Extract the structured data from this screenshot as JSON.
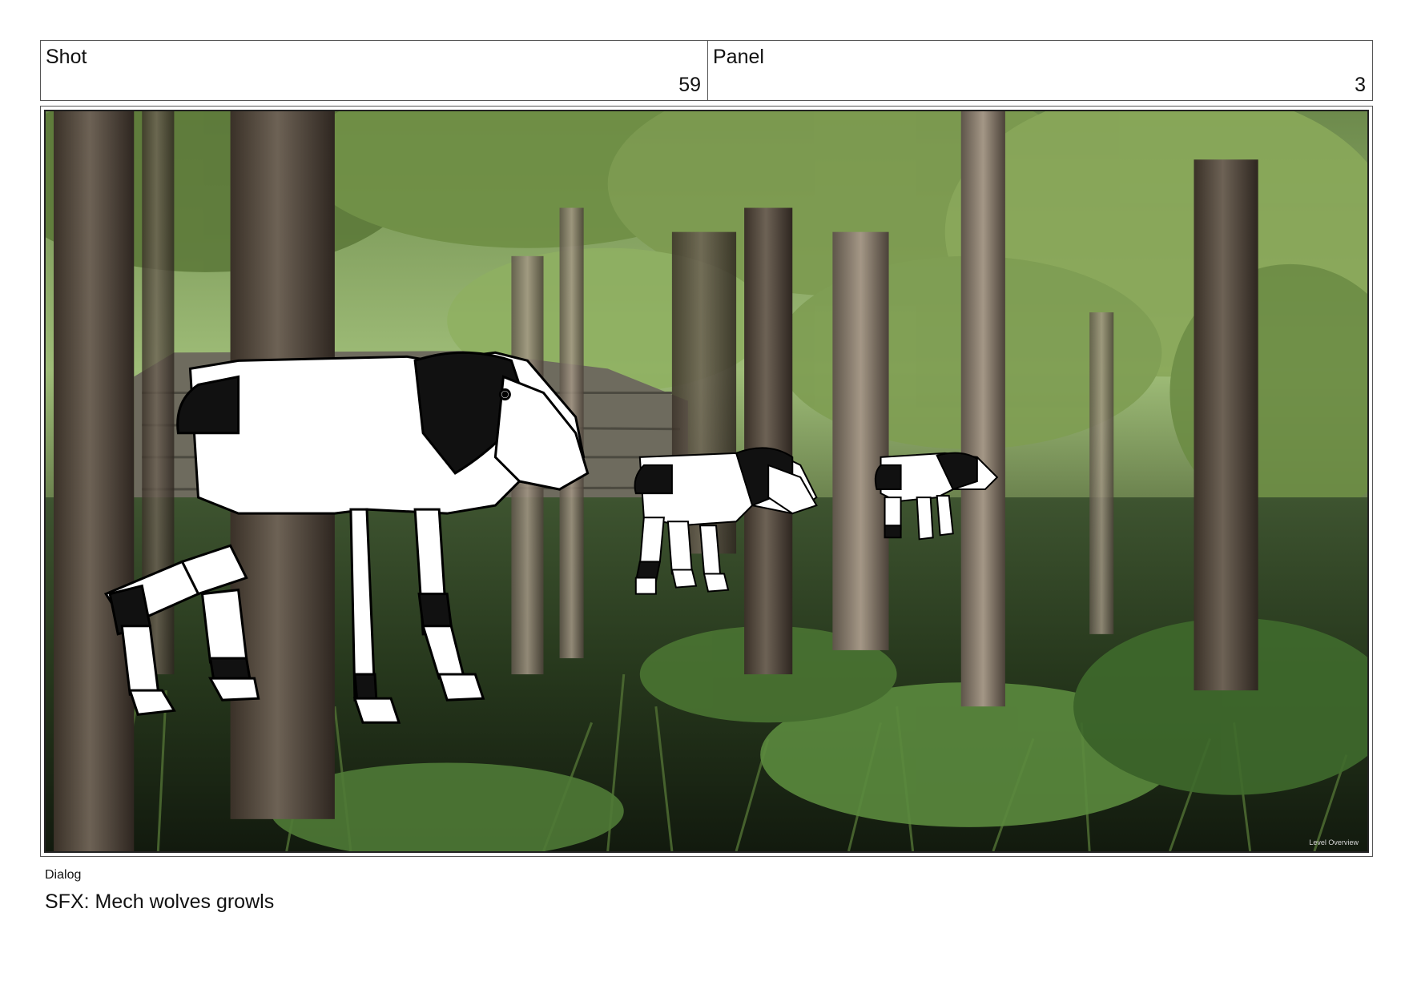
{
  "header": {
    "shot_label": "Shot",
    "shot_number": "59",
    "panel_label": "Panel",
    "panel_number": "3"
  },
  "frame": {
    "overlay_text": "Level  Overview"
  },
  "dialog": {
    "label": "Dialog",
    "text": "SFX: Mech wolves growls"
  }
}
